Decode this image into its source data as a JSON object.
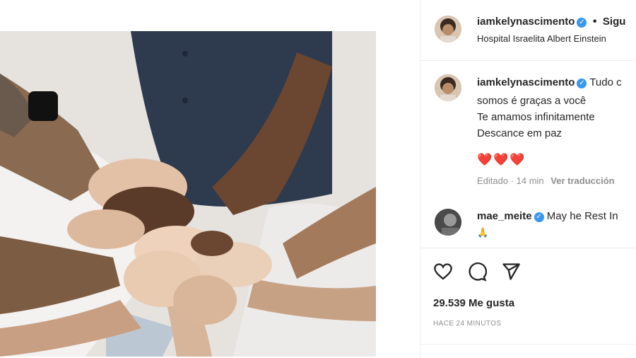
{
  "post": {
    "image_alt": "Hands stacked together over a hospital bed"
  },
  "header": {
    "username": "iamkelynascimento",
    "verified_mark": "✓",
    "separator": "•",
    "follow_label": "Sigu",
    "location": "Hospital Israelita Albert Einstein"
  },
  "caption": {
    "username": "iamkelynascimento",
    "verified_mark": "✓",
    "text_start": "Tudo c",
    "lines": [
      "somos é graças a você",
      "Te amamos infinitamente",
      "Descance em paz"
    ],
    "hearts": "❤️❤️❤️",
    "edited_time": "Editado · 14 min",
    "translate_label": "Ver traducción"
  },
  "comment": {
    "username": "mae_meite",
    "verified_mark": "✓",
    "text": "May he Rest In",
    "emoji": "🙏"
  },
  "actions": {
    "like_icon": "heart-icon",
    "comment_icon": "comment-icon",
    "share_icon": "send-icon"
  },
  "likes": "29.539 Me gusta",
  "timestamp": "HACE 24 MINUTOS",
  "colors": {
    "verified": "#3897f0",
    "heart": "#e0245e",
    "muted": "#8e8e8e",
    "text": "#262626"
  }
}
